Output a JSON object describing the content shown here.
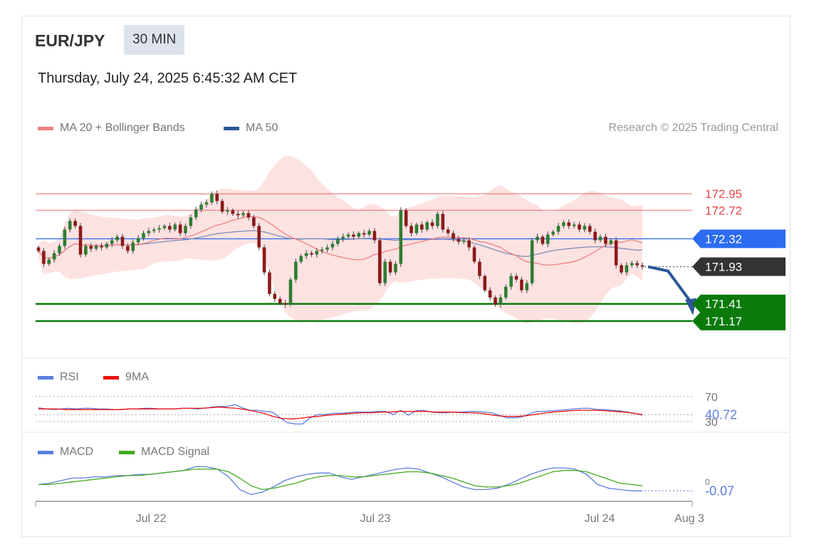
{
  "header": {
    "symbol": "EUR/JPY",
    "timeframe": "30 MIN",
    "datetime": "Thursday, July 24, 2025 6:45:32 AM CET"
  },
  "legend_main": [
    {
      "label": "MA 20 + Bollinger Bands",
      "color": "#f08080"
    },
    {
      "label": "MA 50",
      "color": "#2b5797"
    }
  ],
  "credit": "Research © 2025 Trading Central",
  "legend_rsi": [
    {
      "label": "RSI",
      "color": "#5b7fe0"
    },
    {
      "label": "9MA",
      "color": "#ee1111"
    }
  ],
  "legend_macd": [
    {
      "label": "MACD",
      "color": "#5b7fe0"
    },
    {
      "label": "MACD Signal",
      "color": "#44aa22"
    }
  ],
  "chart_data": [
    {
      "type": "candlestick",
      "ylim": [
        170.68,
        173.45
      ],
      "levels": [
        {
          "label": "172.95",
          "value": 172.95,
          "kind": "resistance",
          "color": "#ee4444"
        },
        {
          "label": "172.72",
          "value": 172.72,
          "kind": "resistance",
          "color": "#ee4444"
        },
        {
          "label": "172.32",
          "value": 172.32,
          "kind": "pivot",
          "color": "#2b6cf0"
        },
        {
          "label": "171.41",
          "value": 171.41,
          "kind": "support",
          "color": "#0a7a0a"
        },
        {
          "label": "171.17",
          "value": 171.17,
          "kind": "support",
          "color": "#0a7a0a"
        }
      ],
      "last_price": {
        "label": "171.93",
        "value": 171.93
      },
      "forecast_path": [
        {
          "bars_ahead": 0,
          "value": 171.93
        },
        {
          "bars_ahead": 4,
          "value": 171.87
        },
        {
          "bars_ahead": 9,
          "value": 171.25
        }
      ],
      "close": [
        172.15,
        171.97,
        172.03,
        172.12,
        172.22,
        172.45,
        172.57,
        172.5,
        172.1,
        172.22,
        172.18,
        172.22,
        172.2,
        172.25,
        172.3,
        172.35,
        172.22,
        172.15,
        172.27,
        172.33,
        172.4,
        172.43,
        172.45,
        172.47,
        172.5,
        172.45,
        172.52,
        172.4,
        172.5,
        172.62,
        172.73,
        172.8,
        172.83,
        172.95,
        172.85,
        172.7,
        172.72,
        172.67,
        172.65,
        172.68,
        172.62,
        172.5,
        172.2,
        171.85,
        171.55,
        171.48,
        171.42,
        171.4,
        171.75,
        172.0,
        172.08,
        172.12,
        172.1,
        172.15,
        172.17,
        172.2,
        172.25,
        172.32,
        172.35,
        172.38,
        172.35,
        172.4,
        172.38,
        172.43,
        172.3,
        171.7,
        172.0,
        171.85,
        171.97,
        172.72,
        172.5,
        172.4,
        172.52,
        172.45,
        172.55,
        172.5,
        172.67,
        172.45,
        172.4,
        172.32,
        172.28,
        172.3,
        172.2,
        172.0,
        171.8,
        171.6,
        171.5,
        171.4,
        171.5,
        171.65,
        171.8,
        171.75,
        171.6,
        171.7,
        172.3,
        172.35,
        172.25,
        172.38,
        172.42,
        172.5,
        172.55,
        172.5,
        172.52,
        172.45,
        172.5,
        172.42,
        172.3,
        172.35,
        172.25,
        172.3,
        171.95,
        171.85,
        171.95,
        171.98,
        171.95,
        171.93
      ]
    },
    {
      "type": "line",
      "title": "RSI",
      "levels": [
        {
          "label": "70",
          "value": 70
        },
        {
          "label": "30",
          "value": 30
        }
      ],
      "last_value": {
        "label": "40.72",
        "value": 40.72
      },
      "series": [
        {
          "name": "RSI",
          "values": [
            52,
            50,
            49,
            50,
            51,
            50,
            51,
            51,
            50,
            50,
            49,
            49,
            50,
            50,
            51,
            51,
            50,
            50,
            50,
            51,
            51,
            50,
            51,
            53,
            54,
            54,
            57,
            52,
            48,
            48,
            46,
            45,
            36,
            28,
            26,
            26,
            36,
            41,
            41,
            43,
            43,
            44,
            45,
            45,
            45,
            46,
            46,
            41,
            48,
            40,
            47,
            48,
            45,
            44,
            44,
            45,
            45,
            46,
            46,
            45,
            44,
            40,
            36,
            36,
            37,
            42,
            46,
            46,
            47,
            48,
            49,
            50,
            51,
            51,
            49,
            49,
            48,
            47,
            45,
            43,
            40
          ]
        },
        {
          "name": "9MA",
          "values": [
            50,
            50,
            50,
            49,
            49,
            49,
            49,
            49,
            49,
            49,
            50,
            50,
            50,
            50,
            50,
            50,
            51,
            51,
            51,
            52,
            53,
            52,
            51,
            49,
            46,
            43,
            38,
            35,
            34,
            35,
            37,
            38,
            40,
            41,
            42,
            43,
            44,
            44,
            45,
            45,
            46,
            46,
            46,
            46,
            45,
            45,
            45,
            44,
            44,
            43,
            41,
            39,
            38,
            38,
            39,
            41,
            43,
            45,
            46,
            47,
            48,
            48,
            48,
            47,
            46,
            45,
            43,
            41
          ]
        }
      ]
    },
    {
      "type": "line",
      "title": "MACD",
      "levels": [
        {
          "label": "0",
          "value": 0
        }
      ],
      "last_value": {
        "label": "-0.07",
        "value": -0.07
      },
      "series": [
        {
          "name": "MACD",
          "values": [
            -0.02,
            -0.01,
            0.01,
            0.03,
            0.03,
            0.04,
            0.04,
            0.05,
            0.05,
            0.06,
            0.06,
            0.07,
            0.08,
            0.09,
            0.12,
            0.12,
            0.1,
            0.04,
            -0.06,
            -0.1,
            -0.08,
            -0.04,
            0.01,
            0.04,
            0.06,
            0.07,
            0.07,
            0.04,
            0.02,
            0.04,
            0.06,
            0.08,
            0.1,
            0.11,
            0.1,
            0.07,
            0.04,
            0.0,
            -0.04,
            -0.06,
            -0.06,
            -0.05,
            -0.02,
            0.02,
            0.06,
            0.09,
            0.11,
            0.11,
            0.1,
            0.06,
            -0.02,
            -0.05,
            -0.06,
            -0.07,
            -0.07
          ]
        },
        {
          "name": "MACD Signal",
          "values": [
            -0.02,
            -0.02,
            -0.01,
            0.0,
            0.01,
            0.02,
            0.03,
            0.04,
            0.05,
            0.05,
            0.06,
            0.07,
            0.08,
            0.09,
            0.1,
            0.1,
            0.1,
            0.08,
            0.03,
            -0.03,
            -0.06,
            -0.05,
            -0.03,
            -0.01,
            0.02,
            0.04,
            0.05,
            0.05,
            0.04,
            0.04,
            0.05,
            0.06,
            0.07,
            0.08,
            0.08,
            0.07,
            0.05,
            0.03,
            0.0,
            -0.03,
            -0.04,
            -0.04,
            -0.03,
            -0.01,
            0.02,
            0.05,
            0.08,
            0.09,
            0.09,
            0.08,
            0.05,
            0.02,
            -0.01,
            -0.02,
            -0.03
          ]
        }
      ]
    },
    {
      "type": "axis",
      "x_ticks": [
        "Jul 22",
        "Jul 23",
        "Jul 24",
        "Aug 3"
      ]
    }
  ]
}
